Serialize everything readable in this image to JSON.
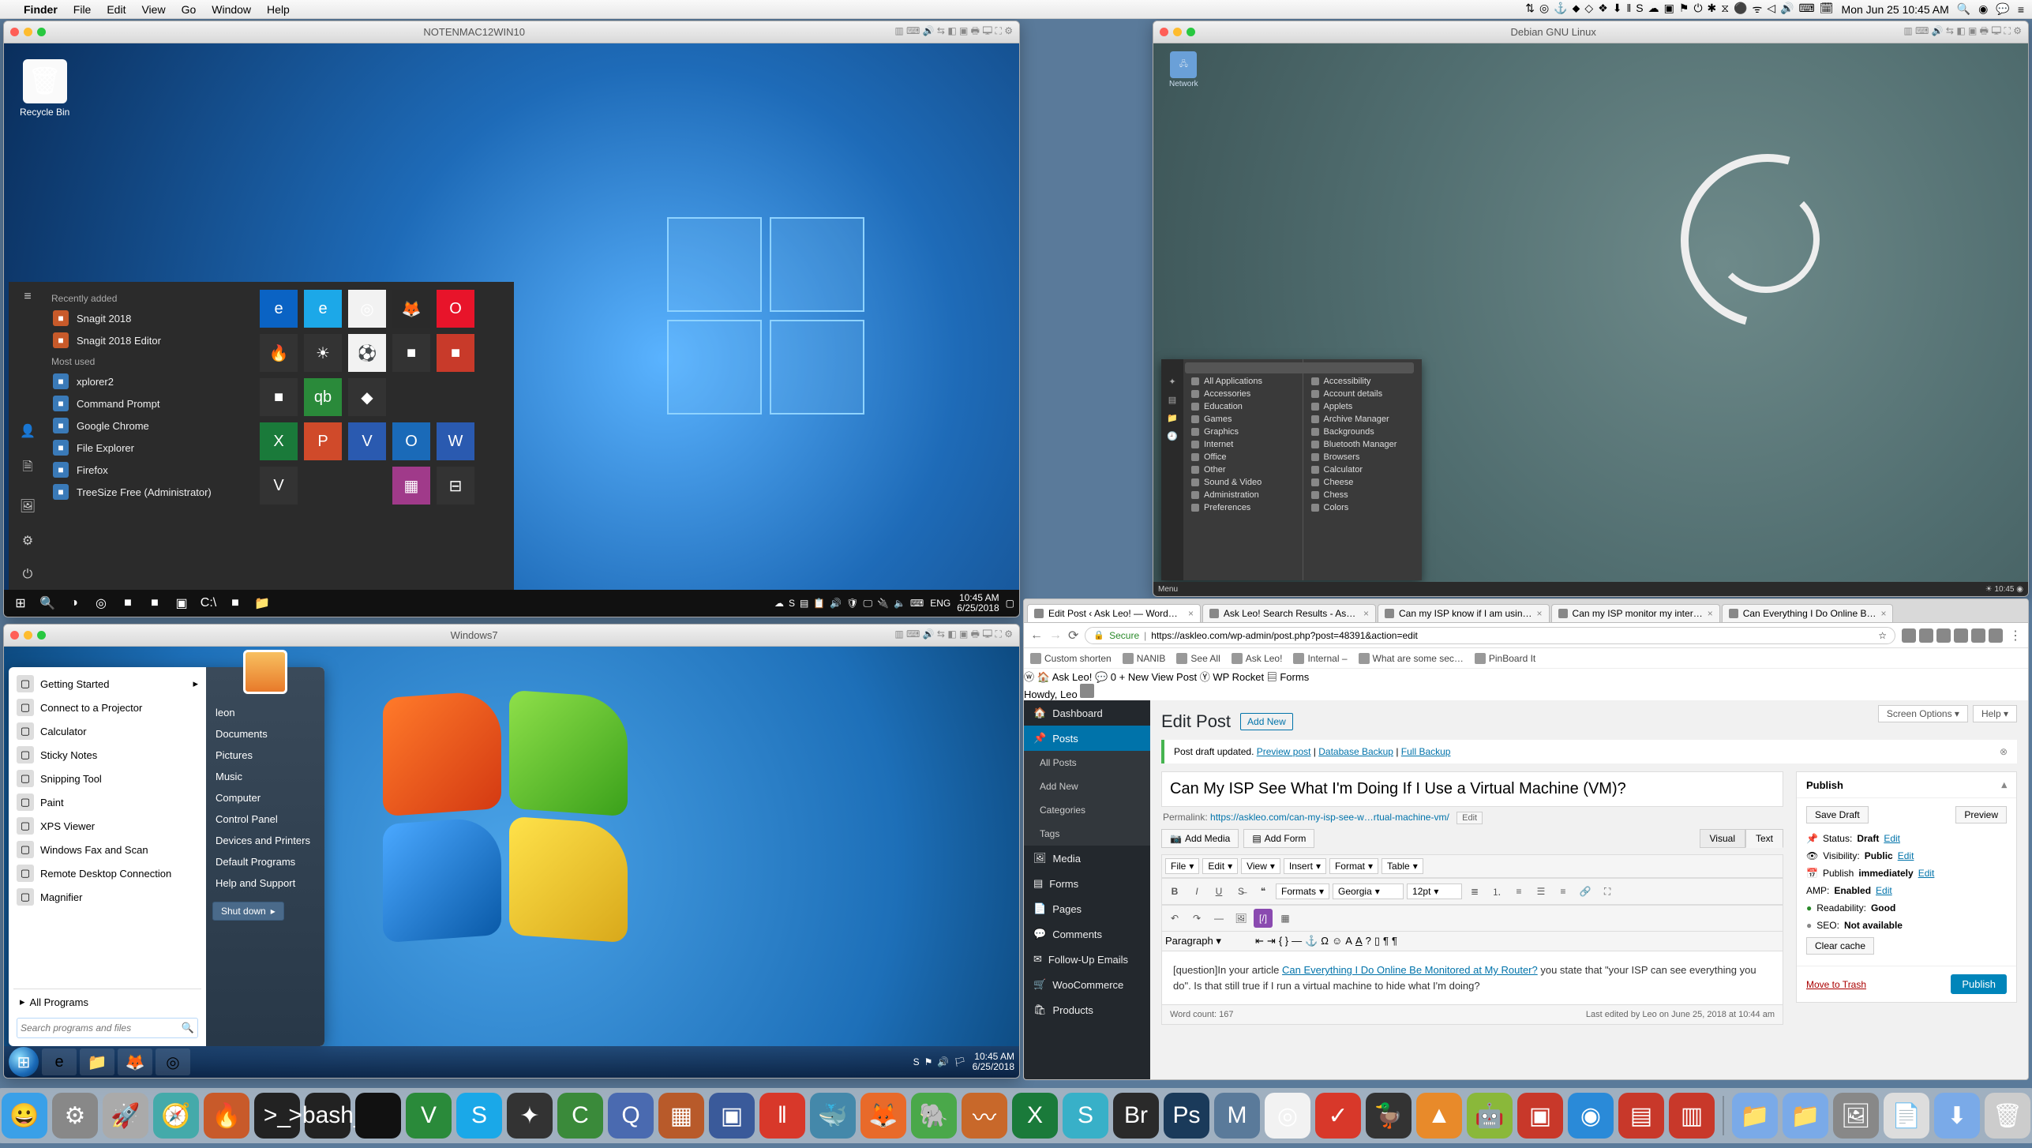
{
  "mac_menubar": {
    "app": "Finder",
    "items": [
      "File",
      "Edit",
      "View",
      "Go",
      "Window",
      "Help"
    ],
    "status_glyphs": [
      "⇅",
      "◎",
      "⚓",
      "⬥",
      "◇",
      "❖",
      "⬇",
      "‖",
      "S",
      "☁",
      "▣",
      "⚑",
      "⏻",
      "✱",
      "⧖",
      "⚫",
      "ᯤ",
      "◁",
      "🔊",
      "⌨",
      "🗓"
    ],
    "datetime": "Mon Jun 25  10:45 AM",
    "right_extra": [
      "🔍",
      "◉",
      "💬",
      "≡"
    ]
  },
  "vms": {
    "win10": {
      "title": "NOTENMAC12WIN10",
      "recycle_label": "Recycle Bin",
      "start": {
        "recently_added_hdr": "Recently added",
        "recently_added": [
          "Snagit 2018",
          "Snagit 2018 Editor"
        ],
        "most_used_hdr": "Most used",
        "most_used": [
          "xplorer2",
          "Command Prompt",
          "Google Chrome",
          "File Explorer",
          "Firefox",
          "TreeSize Free (Administrator)"
        ],
        "tiles": [
          {
            "glyph": "e",
            "bg": "#0a63c4"
          },
          {
            "glyph": "e",
            "bg": "#1ca8e8"
          },
          {
            "glyph": "◎",
            "bg": "#f2f2f2"
          },
          {
            "glyph": "🦊",
            "bg": "#2a2a2a"
          },
          {
            "glyph": "O",
            "bg": "#e8142a"
          },
          {
            "glyph": "🔥",
            "bg": "#333"
          },
          {
            "glyph": "☀",
            "bg": "#333"
          },
          {
            "glyph": "⚽",
            "bg": "#f2f2f2"
          },
          {
            "glyph": "■",
            "bg": "#333"
          },
          {
            "glyph": "■",
            "bg": "#c83a2a"
          },
          {
            "glyph": "■",
            "bg": "#333"
          },
          {
            "glyph": "qb",
            "bg": "#2a8a3a"
          },
          {
            "glyph": "◆",
            "bg": "#333"
          },
          {
            "glyph": "",
            "bg": "#2b2b2b"
          },
          {
            "glyph": "",
            "bg": "#2b2b2b"
          },
          {
            "glyph": "X",
            "bg": "#1a7a3a"
          },
          {
            "glyph": "P",
            "bg": "#d04a2a"
          },
          {
            "glyph": "V",
            "bg": "#2a5ab0"
          },
          {
            "glyph": "O",
            "bg": "#1a6ab8"
          },
          {
            "glyph": "W",
            "bg": "#2a5ab0"
          },
          {
            "glyph": "V",
            "bg": "#333"
          },
          {
            "glyph": "",
            "bg": "#2b2b2b"
          },
          {
            "glyph": "",
            "bg": "#2b2b2b"
          },
          {
            "glyph": "▦",
            "bg": "#a03a8a"
          },
          {
            "glyph": "⊟",
            "bg": "#333"
          }
        ]
      },
      "taskbar": {
        "left": [
          "⊞",
          "🔍",
          "◑",
          "◎",
          "■",
          "■",
          "▣",
          "C:\\",
          "■",
          "📁"
        ],
        "tray": [
          "☁",
          "S",
          "▤",
          "📋",
          "🔊",
          "🛡",
          "🖵",
          "🔌",
          "🔈",
          "⌨"
        ],
        "lang": "ENG",
        "time": "10:45 AM",
        "date": "6/25/2018"
      }
    },
    "debian": {
      "title": "Debian GNU Linux",
      "desktop_icon": "Network",
      "categories": [
        "All Applications",
        "Accessories",
        "Education",
        "Games",
        "Graphics",
        "Internet",
        "Office",
        "Other",
        "Sound & Video",
        "Administration",
        "Preferences"
      ],
      "apps": [
        "Accessibility",
        "Account details",
        "Applets",
        "Archive Manager",
        "Backgrounds",
        "Bluetooth Manager",
        "Browsers",
        "Calculator",
        "Cheese",
        "Chess",
        "Colors"
      ],
      "panel_menu": "Menu",
      "panel_clock": "☀ 10:45 ◉"
    },
    "win7": {
      "title": "Windows7",
      "start": {
        "left": [
          "Getting Started",
          "Connect to a Projector",
          "Calculator",
          "Sticky Notes",
          "Snipping Tool",
          "Paint",
          "XPS Viewer",
          "Windows Fax and Scan",
          "Remote Desktop Connection",
          "Magnifier"
        ],
        "all_programs": "All Programs",
        "search_placeholder": "Search programs and files",
        "right": [
          "leon",
          "Documents",
          "Pictures",
          "Music",
          "Computer",
          "Control Panel",
          "Devices and Printers",
          "Default Programs",
          "Help and Support"
        ],
        "shutdown": "Shut down"
      },
      "taskbar": {
        "pins": [
          "e",
          "📁",
          "🦊",
          "◎"
        ],
        "tray": [
          "S",
          "⚑",
          "🔊",
          "🏳"
        ],
        "time": "10:45 AM",
        "date": "6/25/2018"
      }
    }
  },
  "browser": {
    "tabs": [
      "Edit Post ‹ Ask Leo! — WordP…",
      "Ask Leo! Search Results - Ask…",
      "Can my ISP know if I am usin…",
      "Can my ISP monitor my inter…",
      "Can Everything I Do Online B…"
    ],
    "url_secure": "Secure",
    "url": "https://askleo.com/wp-admin/post.php?post=48391&action=edit",
    "star": "☆",
    "bookmarks": [
      "Custom shorten",
      "NANIB",
      "See All",
      "Ask Leo!",
      "Internal –",
      "What are some sec…",
      "PinBoard It"
    ],
    "adminbar": {
      "site": "Ask Leo!",
      "comments": "0",
      "new": "New",
      "view": "View Post",
      "yoast": "Y",
      "rocket": "WP Rocket",
      "forms": "Forms",
      "howdy": "Howdy, Leo"
    },
    "sidemenu": [
      {
        "label": "Dashboard",
        "icon": "🏠"
      },
      {
        "label": "Posts",
        "icon": "📌",
        "active": true
      },
      {
        "label": "All Posts",
        "sub": true
      },
      {
        "label": "Add New",
        "sub": true
      },
      {
        "label": "Categories",
        "sub": true
      },
      {
        "label": "Tags",
        "sub": true
      },
      {
        "label": "Media",
        "icon": "🖼"
      },
      {
        "label": "Forms",
        "icon": "▤"
      },
      {
        "label": "Pages",
        "icon": "📄"
      },
      {
        "label": "Comments",
        "icon": "💬"
      },
      {
        "label": "Follow-Up Emails",
        "icon": "✉"
      },
      {
        "label": "WooCommerce",
        "icon": "🛒"
      },
      {
        "label": "Products",
        "icon": "🛍"
      }
    ],
    "editor": {
      "heading": "Edit Post",
      "add_new": "Add New",
      "notice_pre": "Post draft updated. ",
      "notice_links": [
        "Preview post",
        "Database Backup",
        "Full Backup"
      ],
      "title_value": "Can My ISP See What I'm Doing If I Use a Virtual Machine (VM)?",
      "permalink_label": "Permalink:",
      "permalink_url": "https://askleo.com/can-my-isp-see-w…rtual-machine-vm/",
      "permalink_edit": "Edit",
      "add_media": "Add Media",
      "add_form": "Add Form",
      "tab_visual": "Visual",
      "tab_text": "Text",
      "toolbar": {
        "file": "File",
        "edit": "Edit",
        "view": "View",
        "insert": "Insert",
        "format": "Format",
        "table": "Table",
        "formats": "Formats",
        "font": "Georgia",
        "size": "12pt",
        "para": "Paragraph"
      },
      "content_pre": "[question]In your article ",
      "content_link": "Can Everything I Do Online Be Monitored at My Router?",
      "content_post": " you state that \"your ISP can see everything you do\". Is that still true if I run a virtual machine to hide what I'm doing?",
      "word_count_label": "Word count: ",
      "word_count": "167",
      "last_edit": "Last edited by Leo on June 25, 2018 at 10:44 am"
    },
    "publish": {
      "title": "Publish",
      "save_draft": "Save Draft",
      "preview": "Preview",
      "status_label": "Status:",
      "status_val": "Draft",
      "status_edit": "Edit",
      "vis_label": "Visibility:",
      "vis_val": "Public",
      "vis_edit": "Edit",
      "pub_label": "Publish",
      "pub_val": "immediately",
      "pub_edit": "Edit",
      "amp_label": "AMP:",
      "amp_val": "Enabled",
      "amp_edit": "Edit",
      "read_label": "Readability:",
      "read_val": "Good",
      "seo_label": "SEO:",
      "seo_val": "Not available",
      "clear_cache": "Clear cache",
      "trash": "Move to Trash",
      "publish_btn": "Publish"
    },
    "screen_options": "Screen Options",
    "help": "Help"
  },
  "dock": [
    {
      "n": "finder",
      "g": "😀",
      "c": "#3aa0e8"
    },
    {
      "n": "sys",
      "g": "⚙",
      "c": "#888"
    },
    {
      "n": "launchpad",
      "g": "🚀",
      "c": "#aaa"
    },
    {
      "n": "safari",
      "g": "🧭",
      "c": "#4aa"
    },
    {
      "n": "firewall",
      "g": "🔥",
      "c": "#c85a2a"
    },
    {
      "n": "term",
      "g": ">_",
      "c": "#222"
    },
    {
      "n": "bash",
      "g": ">bash_",
      "c": "#222"
    },
    {
      "n": "blank",
      "g": "",
      "c": "#111"
    },
    {
      "n": "vim",
      "g": "V",
      "c": "#2a8a3a"
    },
    {
      "n": "skype",
      "g": "S",
      "c": "#1aa8e8"
    },
    {
      "n": "fcpx",
      "g": "✦",
      "c": "#333"
    },
    {
      "n": "camtasia",
      "g": "C",
      "c": "#3a8a3a"
    },
    {
      "n": "qt",
      "g": "Q",
      "c": "#4a6ab0"
    },
    {
      "n": "app1",
      "g": "▦",
      "c": "#b85a2a"
    },
    {
      "n": "vbox",
      "g": "▣",
      "c": "#3a5a9a"
    },
    {
      "n": "parallels",
      "g": "‖",
      "c": "#d8382a"
    },
    {
      "n": "docker",
      "g": "🐳",
      "c": "#48a"
    },
    {
      "n": "firefoxd",
      "g": "🦊",
      "c": "#e86a2a"
    },
    {
      "n": "evernote",
      "g": "🐘",
      "c": "#4aa84a"
    },
    {
      "n": "audio",
      "g": "〰",
      "c": "#c8682a"
    },
    {
      "n": "excel",
      "g": "X",
      "c": "#1a7a3a"
    },
    {
      "n": "snagit",
      "g": "S",
      "c": "#38b0c8"
    },
    {
      "n": "bridge",
      "g": "Br",
      "c": "#2a2a2a"
    },
    {
      "n": "ps",
      "g": "Ps",
      "c": "#1a3a5a"
    },
    {
      "n": "mamp",
      "g": "M",
      "c": "#5a7a9a"
    },
    {
      "n": "chrome",
      "g": "◎",
      "c": "#f2f2f2"
    },
    {
      "n": "todoist",
      "g": "✓",
      "c": "#d8382a"
    },
    {
      "n": "duck",
      "g": "🦆",
      "c": "#333"
    },
    {
      "n": "vlc",
      "g": "▲",
      "c": "#e88a2a"
    },
    {
      "n": "android",
      "g": "🤖",
      "c": "#8ab83a"
    },
    {
      "n": "vm1",
      "g": "▣",
      "c": "#c8382a"
    },
    {
      "n": "tv",
      "g": "◉",
      "c": "#2a8ad8"
    },
    {
      "n": "vm2",
      "g": "▤",
      "c": "#c8382a"
    },
    {
      "n": "vm3",
      "g": "▥",
      "c": "#c8382a"
    }
  ],
  "dock_right": [
    {
      "n": "folder1",
      "g": "📁",
      "c": "#7aaae8"
    },
    {
      "n": "folder2",
      "g": "📁",
      "c": "#7aaae8"
    },
    {
      "n": "desktop",
      "g": "🖼",
      "c": "#888"
    },
    {
      "n": "doc",
      "g": "📄",
      "c": "#ddd"
    },
    {
      "n": "downloads",
      "g": "⬇",
      "c": "#7aaae8"
    },
    {
      "n": "trash",
      "g": "🗑",
      "c": "#ccc"
    }
  ]
}
